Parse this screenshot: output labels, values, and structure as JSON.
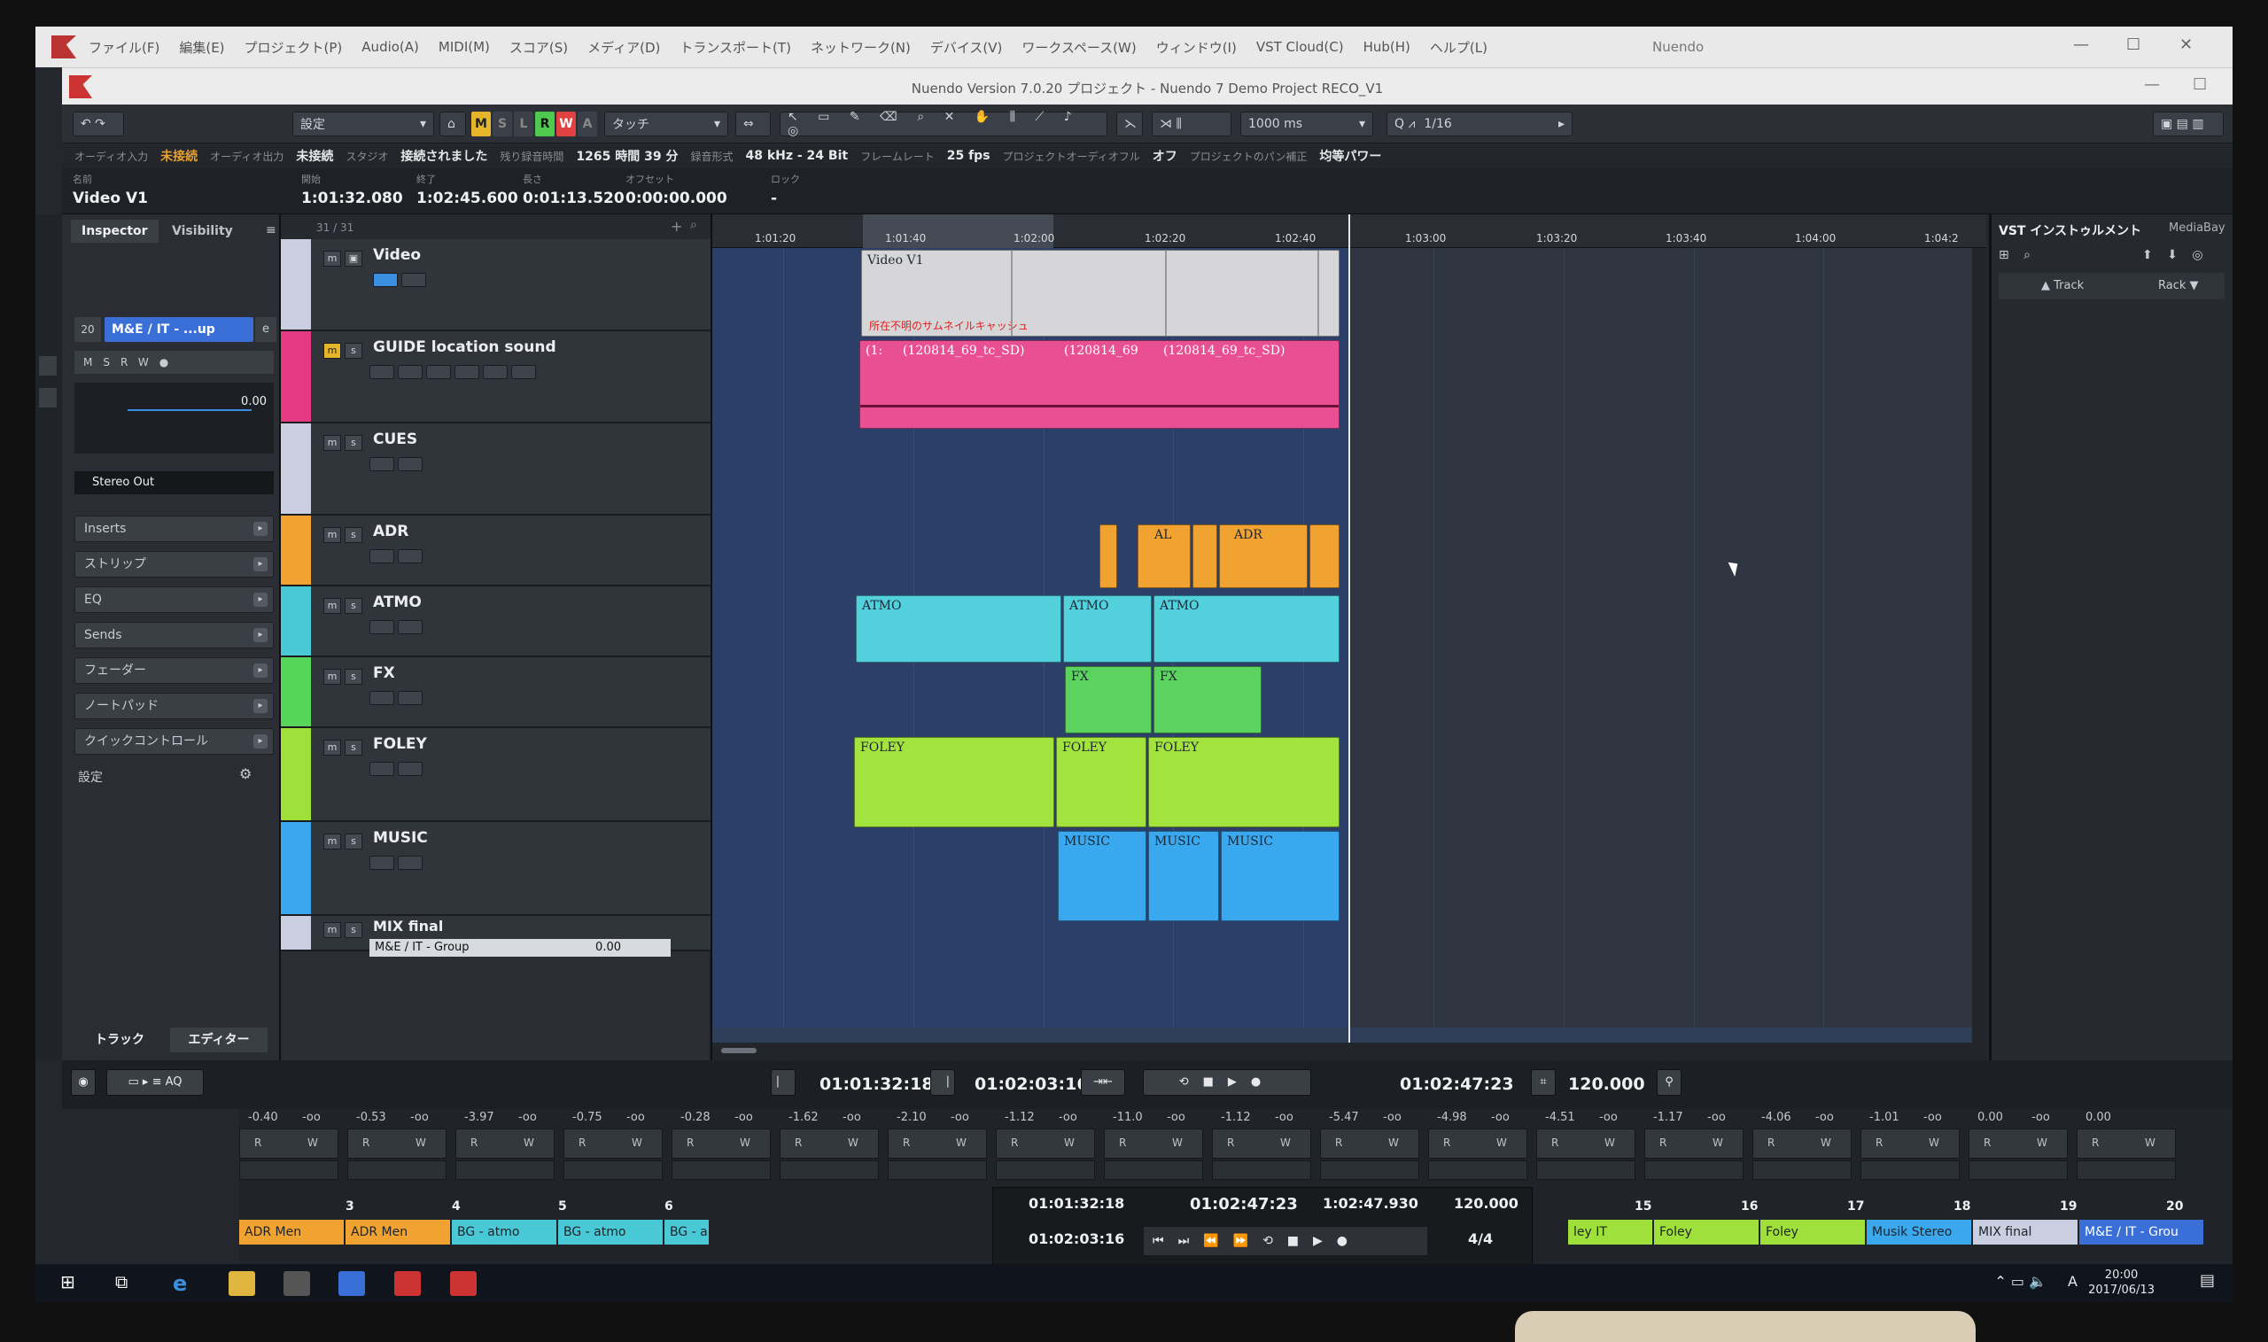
{
  "menubar": {
    "items": [
      "ファイル(F)",
      "編集(E)",
      "プロジェクト(P)",
      "Audio(A)",
      "MIDI(M)",
      "スコア(S)",
      "メディア(D)",
      "トランスポート(T)",
      "ネットワーク(N)",
      "デバイス(V)",
      "ワークスペース(W)",
      "ウィンドウ(I)",
      "VST Cloud(C)",
      "Hub(H)",
      "ヘルプ(L)"
    ],
    "app": "Nuendo"
  },
  "title": "Nuendo Version 7.0.20 プロジェクト - Nuendo 7 Demo Project RECO_V1",
  "toolbar": {
    "preset": "設定",
    "mode_letters": [
      "M",
      "S",
      "L",
      "R",
      "W",
      "A"
    ],
    "snap": "タッチ",
    "nudge": "1000 ms",
    "quantize": "1/16"
  },
  "status": {
    "audio_in_label": "オーディオ入力",
    "audio_in_value": "未接続",
    "audio_out_label": "オーディオ出力",
    "audio_out_value": "未接続",
    "studio_label": "スタジオ",
    "studio_value": "接続されました",
    "rec_time_label": "残り録音時間",
    "rec_time_value": "1265 時間 39 分",
    "format_label": "録音形式",
    "format_value": "48 kHz - 24 Bit",
    "fps_label": "フレームレート",
    "fps_value": "25 fps",
    "pan_label": "プロジェクトオーディオフル",
    "pan_value": "オフ",
    "panlaw_label": "プロジェクトのパン補正",
    "panlaw_value": "均等パワー"
  },
  "infoline": [
    {
      "k": "名前",
      "v": "Video V1"
    },
    {
      "k": "開始",
      "v": "1:01:32.080"
    },
    {
      "k": "終了",
      "v": "1:02:45.600"
    },
    {
      "k": "長さ",
      "v": "0:01:13.520"
    },
    {
      "k": "オフセット",
      "v": "0:00:00.000"
    },
    {
      "k": "ロック",
      "v": "-"
    }
  ],
  "inspector": {
    "tab1": "Inspector",
    "tab2": "Visibility",
    "track": "M&E / IT - ...up",
    "volume": "0.00",
    "output": "Stereo Out",
    "sections": [
      "Inserts",
      "ストリップ",
      "EQ",
      "Sends",
      "フェーダー",
      "ノートパッド",
      "クイックコントロール"
    ],
    "settings": "設定",
    "bottom_tabs": [
      "トラック",
      "エディター"
    ]
  },
  "tracklist": {
    "count": "31 / 31",
    "tracks": [
      {
        "name": "Video",
        "color": "#c9cfe0"
      },
      {
        "name": "GUIDE location sound",
        "color": "#e33a83"
      },
      {
        "name": "CUES",
        "color": "#c9cfe0"
      },
      {
        "name": "ADR",
        "color": "#f0a330"
      },
      {
        "name": "ATMO",
        "color": "#49c9d6"
      },
      {
        "name": "FX",
        "color": "#57d45a"
      },
      {
        "name": "FOLEY",
        "color": "#9fe03a"
      },
      {
        "name": "MUSIC",
        "color": "#3ba8ee"
      },
      {
        "name": "MIX final",
        "color": "#c9cfe0"
      }
    ],
    "group_label": "M&E / IT - Group",
    "group_value": "0.00"
  },
  "ruler": [
    "1:01:20",
    "1:01:40",
    "1:02:00",
    "1:02:20",
    "1:02:40",
    "1:03:00",
    "1:03:20",
    "1:03:40",
    "1:04:00",
    "1:04:2"
  ],
  "events": {
    "video": "Video V1",
    "video_sub": "所在不明のサムネイルキャッシュ",
    "guide1": "(1:",
    "guide2": "(120814_69_tc_SD)",
    "guide3": "(120814_69",
    "guide4": "(120814_69_tc_SD)",
    "adr1": "AL",
    "adr2": "ADR",
    "atmo": "ATMO",
    "fx": "FX",
    "foley": "FOLEY",
    "music": "MUSIC"
  },
  "rightzone": {
    "title": "VST インストゥルメント",
    "tab2": "MediaBay",
    "track": "Track",
    "rack": "Rack"
  },
  "transport": {
    "left": "01:01:32:18",
    "right": "01:02:03:16",
    "pos": "01:02:47:23",
    "tempo": "120.000"
  },
  "mixer": {
    "db": [
      "-0.40",
      "-oo",
      "-0.53",
      "-oo",
      "-3.97",
      "-oo",
      "-0.75",
      "-oo",
      "-0.28",
      "-oo",
      "-1.62",
      "-oo",
      "-2.10",
      "-oo",
      "-1.12",
      "-oo",
      "-11.0",
      "-oo",
      "-1.12",
      "-oo",
      "-5.47",
      "-oo",
      "-4.98",
      "-oo",
      "-4.51",
      "-oo",
      "-1.17",
      "-oo",
      "-4.06",
      "-oo",
      "-1.01",
      "-oo",
      "0.00",
      "-oo",
      "0.00"
    ],
    "nums_left": [
      "3",
      "4",
      "5",
      "6"
    ],
    "names_left": [
      "ADR Men",
      "ADR Men",
      "BG - atmo",
      "BG - atmo",
      "BG - a"
    ],
    "nums_right": [
      "15",
      "16",
      "17",
      "18",
      "19",
      "20"
    ],
    "names_right": [
      "ley IT",
      "Foley",
      "Foley",
      "Musik Stereo",
      "MIX final",
      "M&E / IT - Grou"
    ],
    "mini_left": "01:01:32:18",
    "mini_right": "01:02:03:16",
    "mini_pos": "01:02:47:23",
    "mini_time": "1:02:47.930",
    "mini_tempo": "120.000",
    "mini_sig": "4/4"
  },
  "taskbar": {
    "time": "20:00",
    "date": "2017/06/13",
    "ime": "A"
  }
}
